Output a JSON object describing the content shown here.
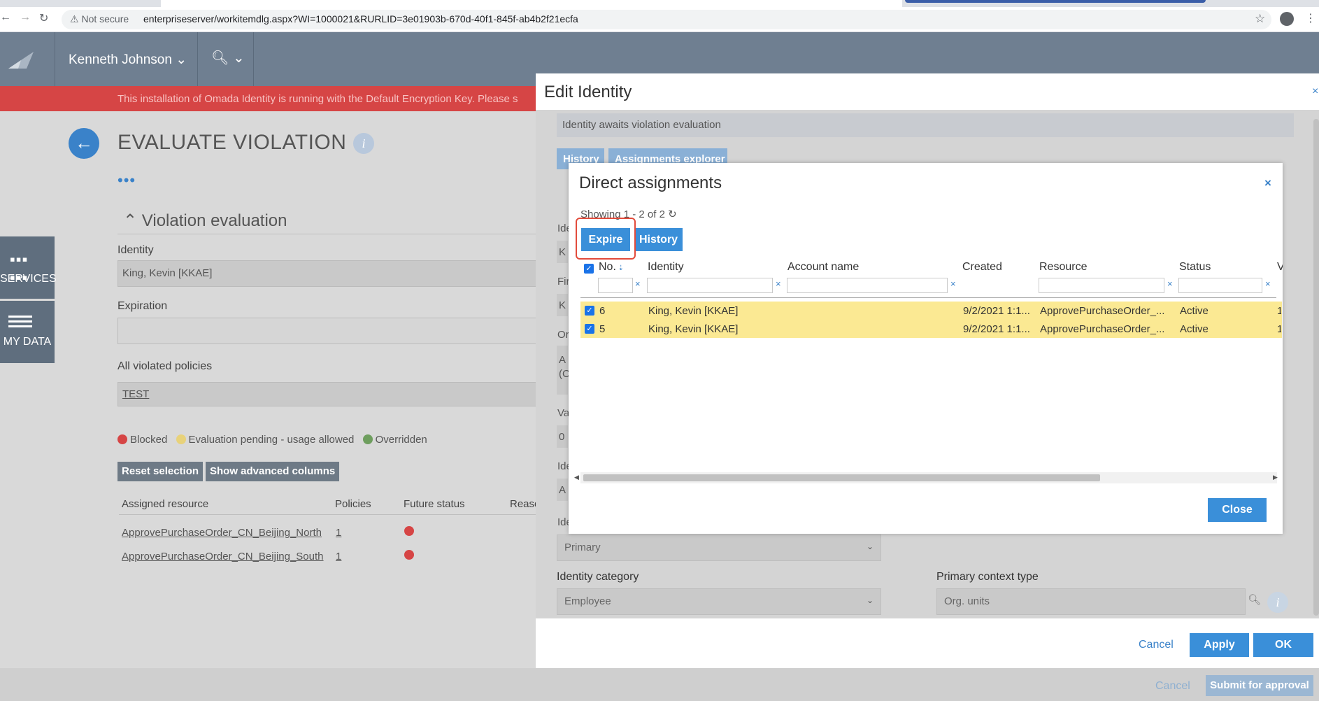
{
  "browser": {
    "security_label": "Not secure",
    "url": "enterpriseserver/workitemdlg.aspx?WI=1000021&RURLID=3e01903b-670d-40f1-845f-ab4b2f21ecfa"
  },
  "topbar": {
    "user_name": "Kenneth Johnson",
    "warning": "This installation of Omada Identity is running with the Default Encryption Key. Please s"
  },
  "sidenav": {
    "services_label": "SERVICES",
    "mydata_label": "MY DATA"
  },
  "page": {
    "title": "EVALUATE VIOLATION",
    "more": "•••",
    "section_title": "Violation evaluation",
    "identity_label": "Identity",
    "identity_value": "King, Kevin [KKAE]",
    "expiration_label": "Expiration",
    "expiration_value": "",
    "policies_label": "All violated policies",
    "policies_value": "TEST",
    "legend": {
      "blocked": "Blocked",
      "pending": "Evaluation pending - usage allowed",
      "overridden": "Overridden"
    },
    "reset_btn": "Reset selection",
    "advanced_btn": "Show advanced columns",
    "columns": [
      "Assigned resource",
      "Policies",
      "Future status",
      "Reaso"
    ],
    "rows": [
      {
        "resource": "ApprovePurchaseOrder_CN_Beijing_North",
        "policies": "1"
      },
      {
        "resource": "ApprovePurchaseOrder_CN_Beijing_South",
        "policies": "1"
      }
    ],
    "footer_cancel": "Cancel",
    "footer_submit": "Submit for approval"
  },
  "edit_identity": {
    "title": "Edit Identity",
    "close": "×",
    "status_msg": "Identity awaits violation evaluation",
    "tabs": [
      "History",
      "Assignments explorer"
    ],
    "side_labels": [
      "Ide",
      "Fir",
      "Or",
      "Va",
      "Ide",
      "Ide"
    ],
    "side_values": [
      "K",
      "K",
      "A",
      "(C",
      "0",
      "A"
    ],
    "identity_type_value": "Primary",
    "category_label": "Identity category",
    "category_value": "Employee",
    "context_label": "Primary context type",
    "context_value": "Org. units",
    "cancel": "Cancel",
    "apply": "Apply",
    "ok": "OK"
  },
  "direct_assignments": {
    "title": "Direct assignments",
    "close": "×",
    "count": "Showing 1 - 2 of 2",
    "refresh": "↻",
    "expire_btn": "Expire",
    "history_btn": "History",
    "columns": [
      "No.",
      "Identity",
      "Account name",
      "Created",
      "Resource",
      "Status",
      "V"
    ],
    "rows": [
      {
        "no": "6",
        "identity": "King, Kevin [KKAE]",
        "account": "",
        "created": "9/2/2021 1:1...",
        "resource": "ApprovePurchaseOrder_...",
        "status": "Active",
        "v": "1"
      },
      {
        "no": "5",
        "identity": "King, Kevin [KKAE]",
        "account": "",
        "created": "9/2/2021 1:1...",
        "resource": "ApprovePurchaseOrder_...",
        "status": "Active",
        "v": "1"
      }
    ],
    "close_btn": "Close"
  }
}
